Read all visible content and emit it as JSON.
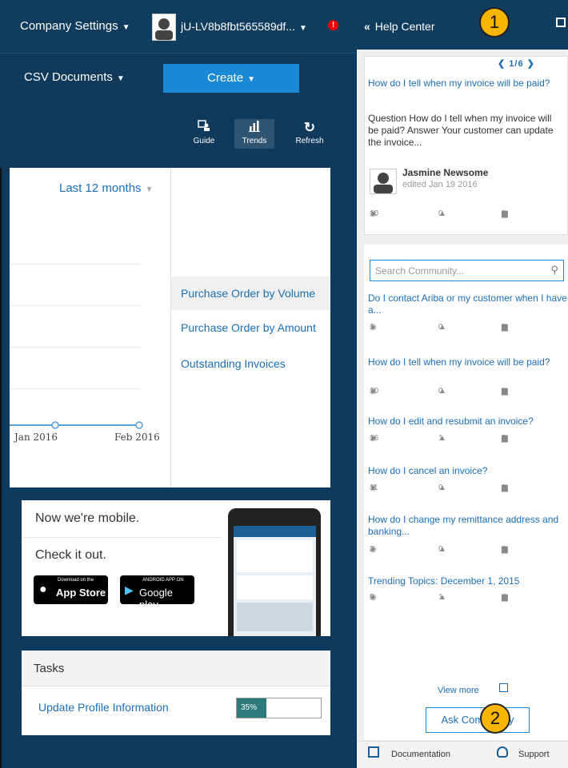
{
  "header": {
    "company_settings": "Company Settings",
    "user": "jU-LV8b8fbt565589df...",
    "alert": "!",
    "csv_documents": "CSV Documents",
    "create": "Create"
  },
  "toolbar": {
    "guide": "Guide",
    "trends": "Trends",
    "refresh": "Refresh"
  },
  "chart": {
    "period": "Last 12 months",
    "x_labels": [
      "Jan 2016",
      "Feb 2016"
    ],
    "menu": [
      "Purchase Order by Volume",
      "Purchase Order by Amount",
      "Outstanding Invoices"
    ]
  },
  "mobile": {
    "title": "Now we're mobile.",
    "check": "Check it out.",
    "appstore_small": "Download on the",
    "appstore_big": "App Store",
    "google_small": "ANDROID APP ON",
    "google_big": "Google play"
  },
  "tasks": {
    "title": "Tasks",
    "item": "Update Profile Information",
    "progress_label": "35%",
    "progress_value": 0.35
  },
  "help": {
    "title": "Help Center",
    "pager": "1/6",
    "featured": {
      "question": "How do I tell when my invoice will be paid?",
      "excerpt": "Question How do I tell when my invoice will be paid? Answer Your customer can update the invoice...",
      "author": "Jasmine Newsome",
      "edited": "edited Jan 19 2016",
      "views": "10",
      "likes": "0",
      "replies": "1"
    },
    "search_placeholder": "Search Community...",
    "topics": [
      {
        "title": "Do I contact Ariba or my customer when I have a...",
        "views": "1",
        "likes": "0",
        "replies": "0"
      },
      {
        "title": "How do I tell when my invoice will be paid?",
        "views": "10",
        "likes": "0",
        "replies": "1"
      },
      {
        "title": "How do I edit and resubmit an invoice?",
        "views": "16",
        "likes": "1",
        "replies": "2"
      },
      {
        "title": "How do I cancel an invoice?",
        "views": "11",
        "likes": "0",
        "replies": "0"
      },
      {
        "title": "How do I change my remittance address and banking...",
        "views": "2",
        "likes": "0",
        "replies": "0"
      },
      {
        "title": "Trending Topics: December 1, 2015",
        "views": "8",
        "likes": "1",
        "replies": "4"
      }
    ],
    "view_more": "View more",
    "ask": "Ask Community",
    "documentation": "Documentation",
    "support": "Support"
  },
  "callouts": [
    "1",
    "2"
  ],
  "colors": {
    "navy": "#0f3a5c",
    "accent_blue": "#1b8ad6",
    "link_blue": "#1b6fb6",
    "callout": "#f7b500"
  }
}
